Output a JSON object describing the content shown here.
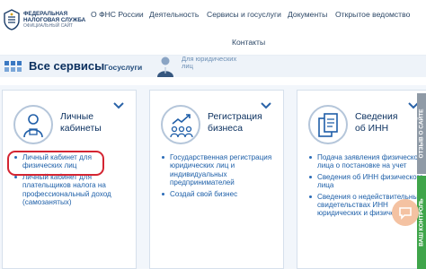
{
  "header": {
    "logo": {
      "line1": "ФЕДЕРАЛЬНАЯ",
      "line2": "НАЛОГОВАЯ СЛУЖБА",
      "line3": "ОФИЦИАЛЬНЫЙ САЙТ"
    },
    "nav": [
      "О ФНС России",
      "Деятельность",
      "Сервисы и госуслуги",
      "Документы",
      "Открытое ведомство",
      "Контакты"
    ]
  },
  "services_band": {
    "title": "Все сервисы",
    "tab_active": "Госуслуги",
    "tab_secondary_line1": "Для юридических",
    "tab_secondary_line2": "лиц"
  },
  "cards": [
    {
      "title_line1": "Личные",
      "title_line2": "кабинеты",
      "icon": "person-id-icon",
      "links": [
        "Личный кабинет для физических лиц",
        "Личный кабинет для плательщиков налога на профессиональный доход (самозанятых)"
      ]
    },
    {
      "title_line1": "Регистрация",
      "title_line2": "бизнеса",
      "icon": "business-growth-icon",
      "links": [
        "Государственная регистрация юридических лиц и индивидуальных предпринимателей",
        "Создай свой бизнес"
      ]
    },
    {
      "title_line1": "Сведения",
      "title_line2": "об ИНН",
      "icon": "documents-icon",
      "links": [
        "Подача заявления физического лица о постановке на учет",
        "Сведения об ИНН физического лица",
        "Сведения о недействительных свидетельствах ИНН юридических и физических лиц"
      ]
    }
  ],
  "side_tabs": {
    "rate_site": "ОТЗЫВ О САЙТЕ",
    "tax_control": "ВАШ КОНТРОЛЬ"
  },
  "colors": {
    "brand_dark": "#0a2f5e",
    "link": "#1d5fa8",
    "highlight": "#d42532",
    "band": "#eef3f9",
    "green_tab": "#3fa54a",
    "gray_tab": "#8f9aa6"
  }
}
